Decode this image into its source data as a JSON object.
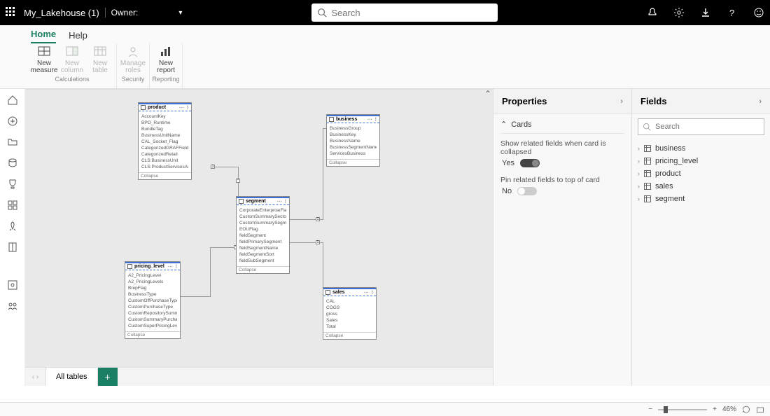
{
  "titlebar": {
    "title": "My_Lakehouse (1)",
    "owner_label": "Owner:",
    "search_placeholder": "Search"
  },
  "tabs": {
    "home": "Home",
    "help": "Help"
  },
  "ribbon": {
    "new_measure": "New measure",
    "new_column": "New column",
    "new_table": "New table",
    "manage_roles": "Manage roles",
    "new_report": "New report",
    "g_calc": "Calculations",
    "g_sec": "Security",
    "g_rep": "Reporting"
  },
  "canvas": {
    "tables": {
      "product": {
        "name": "product",
        "fields": [
          "AccountKey",
          "BPO_Runtime",
          "BundleTag",
          "BusinessUnitName",
          "CAL_Socket_Flag",
          "CategorizedGRAFField",
          "CategorizedRetail",
          "CLS:BusinessUnit",
          "CLS:ProductServicesAndDevices"
        ],
        "collapse": "Collapse"
      },
      "business": {
        "name": "business",
        "fields": [
          "BusinessGroup",
          "BusinessKey",
          "BusinessName",
          "BusinessSegmentName",
          "ServicesBusiness"
        ],
        "collapse": "Collapse"
      },
      "segment": {
        "name": "segment",
        "fields": [
          "CorporateEnterpriseFlag",
          "CustomSummarySector",
          "CustomSummarySegment",
          "EOUFlag",
          "fieldSegment",
          "fieldPrimarySegment",
          "fieldSegmentName",
          "fieldSegmentSort",
          "fieldSubSegment"
        ],
        "collapse": "Collapse"
      },
      "pricing_level": {
        "name": "pricing_level",
        "fields": [
          "A2_PricingLevel",
          "A2_PricingLevels",
          "BrepFlag",
          "BusinessType",
          "CustomOffPurchaseType",
          "CustomPurchaseType",
          "CustomRepositorySummaryAccType",
          "CustomSummaryPurchaseType",
          "CustomSuperPricingLevel"
        ],
        "collapse": "Collapse"
      },
      "sales": {
        "name": "sales",
        "fields": [
          "CAL",
          "COGS",
          "gross",
          "Sales",
          "Total"
        ],
        "collapse": "Collapse"
      }
    }
  },
  "bottomtabs": {
    "all_tables": "All tables"
  },
  "properties": {
    "title": "Properties",
    "section": "Cards",
    "opt1": "Show related fields when card is collapsed",
    "opt1_val": "Yes",
    "opt2": "Pin related fields to top of card",
    "opt2_val": "No"
  },
  "fields": {
    "title": "Fields",
    "search_placeholder": "Search",
    "items": [
      "business",
      "pricing_level",
      "product",
      "sales",
      "segment"
    ]
  },
  "status": {
    "zoom": "46%"
  },
  "leftnav_icons": [
    "home-icon",
    "plus-circle-icon",
    "folder-icon",
    "data-hub-icon",
    "trophy-icon",
    "apps-icon",
    "rocket-icon",
    "book-icon",
    "workspace-icon",
    "people-icon"
  ],
  "top_right_icons": [
    "bell-icon",
    "gear-icon",
    "download-icon",
    "help-icon",
    "smile-icon"
  ]
}
